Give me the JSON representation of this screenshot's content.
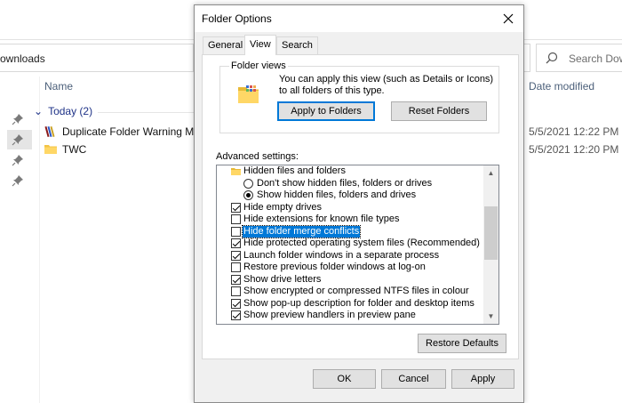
{
  "explorer": {
    "address_text": "ownloads",
    "search_placeholder": "Search Dow",
    "columns": {
      "name": "Name",
      "date_modified": "Date modified"
    },
    "group_label": "Today (2)",
    "files": [
      {
        "name": "Duplicate Folder Warning Me",
        "date": "5/5/2021 12:22 PM",
        "icon": "winrar-archive-icon"
      },
      {
        "name": "TWC",
        "date": "5/5/2021 12:20 PM",
        "icon": "folder-icon"
      }
    ]
  },
  "dialog": {
    "title": "Folder Options",
    "tabs": [
      "General",
      "View",
      "Search"
    ],
    "active_tab": "View",
    "folder_views": {
      "label": "Folder views",
      "description": "You can apply this view (such as Details or Icons) to all folders of this type.",
      "apply_button": "Apply to Folders",
      "reset_button": "Reset Folders"
    },
    "advanced_label": "Advanced settings:",
    "advanced_items": [
      {
        "type": "folder",
        "label": "Hidden files and folders"
      },
      {
        "type": "radio",
        "label": "Don't show hidden files, folders or drives",
        "checked": false
      },
      {
        "type": "radio",
        "label": "Show hidden files, folders and drives",
        "checked": true
      },
      {
        "type": "check",
        "label": "Hide empty drives",
        "checked": true
      },
      {
        "type": "check",
        "label": "Hide extensions for known file types",
        "checked": false
      },
      {
        "type": "check",
        "label": "Hide folder merge conflicts",
        "checked": false,
        "selected": true
      },
      {
        "type": "check",
        "label": "Hide protected operating system files (Recommended)",
        "checked": true
      },
      {
        "type": "check",
        "label": "Launch folder windows in a separate process",
        "checked": true
      },
      {
        "type": "check",
        "label": "Restore previous folder windows at log-on",
        "checked": false
      },
      {
        "type": "check",
        "label": "Show drive letters",
        "checked": true
      },
      {
        "type": "check",
        "label": "Show encrypted or compressed NTFS files in colour",
        "checked": false
      },
      {
        "type": "check",
        "label": "Show pop-up description for folder and desktop items",
        "checked": true
      },
      {
        "type": "check",
        "label": "Show preview handlers in preview pane",
        "checked": true
      }
    ],
    "restore_defaults_button": "Restore Defaults",
    "ok_button": "OK",
    "cancel_button": "Cancel",
    "apply_button": "Apply"
  },
  "colors": {
    "accent": "#0078d7",
    "group_header": "#1e3287",
    "dialog_bg": "#f0f0f0"
  }
}
